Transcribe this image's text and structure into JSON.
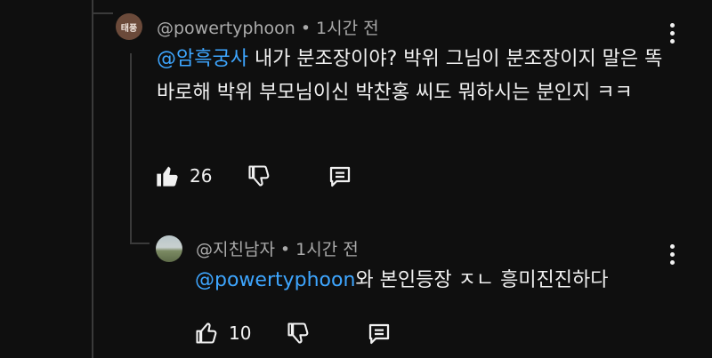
{
  "comment": {
    "avatar_text": "태풍",
    "author": "@powertyphoon",
    "separator": "•",
    "time": "1시간 전",
    "mention": "@암흑궁사",
    "text": " 내가 분조장이야? 박위 그님이 분조장이지 말은 똑바로해 박위 부모님이신 박찬홍 씨도 뭐하시는 분인지 ㅋㅋ",
    "likes": "26"
  },
  "reply": {
    "author": "@지친남자",
    "separator": "•",
    "time": "1시간 전",
    "mention": "@powertyphoon",
    "text": "와 본인등장 ㅈㄴ 흥미진진하다",
    "likes": "10"
  },
  "icons": {
    "like": "thumbs-up-icon",
    "dislike": "thumbs-down-icon",
    "reply": "reply-comment-icon",
    "more": "more-vert-icon"
  },
  "colors": {
    "background": "#0f0f0f",
    "mention": "#3ea6ff",
    "meta": "#aaaaaa",
    "thread": "#3a3a3a"
  }
}
